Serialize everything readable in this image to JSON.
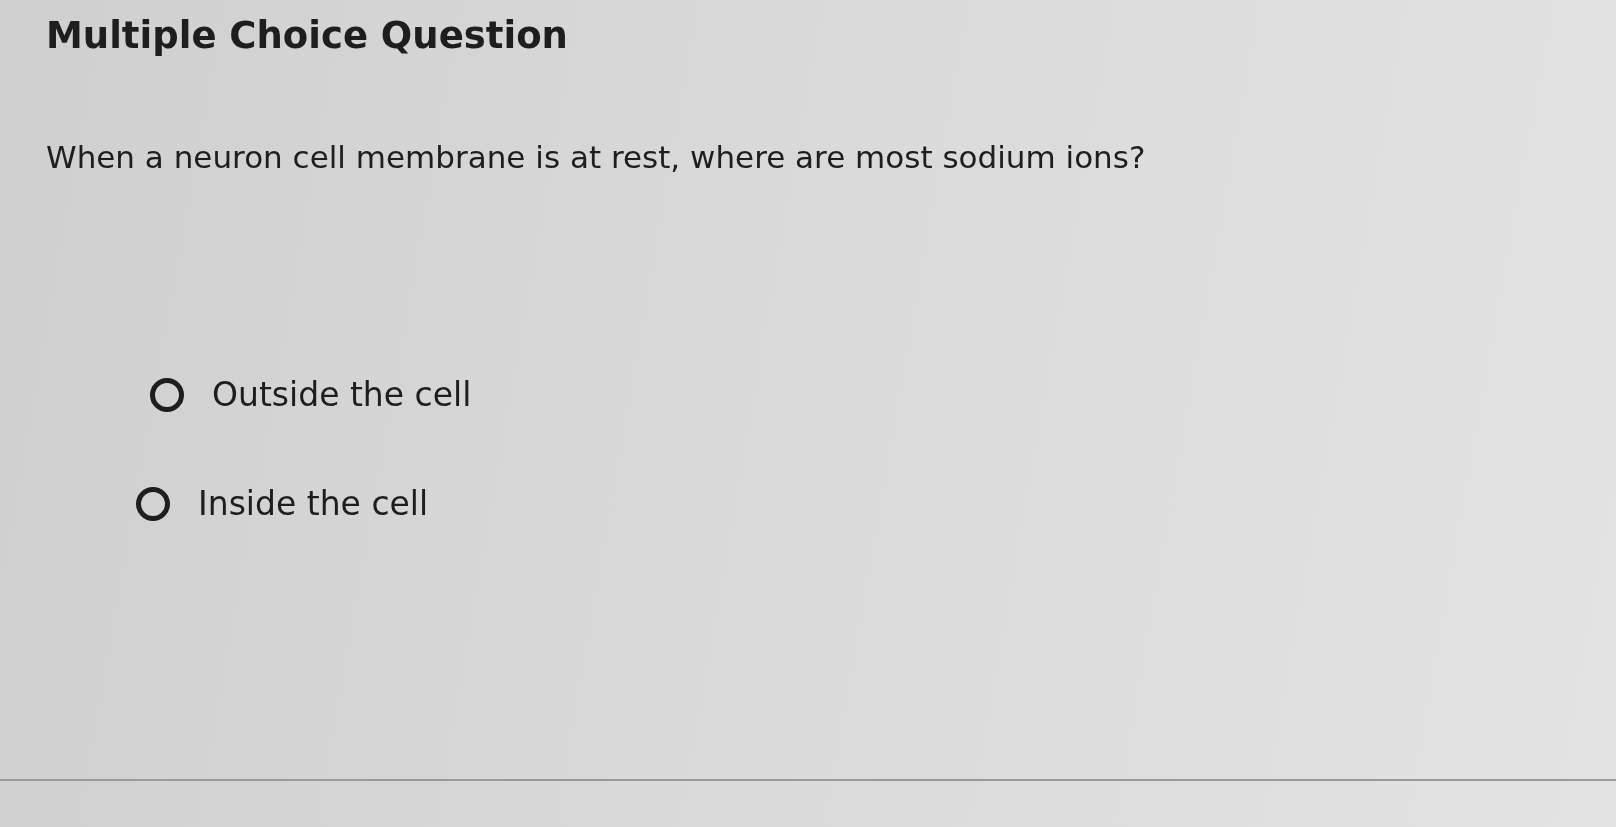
{
  "title": "Multiple Choice Question",
  "question": "When a neuron cell membrane is at rest, where are most sodium ions?",
  "options": [
    {
      "label": "Outside the cell",
      "selected": false
    },
    {
      "label": "Inside the cell",
      "selected": false
    }
  ]
}
